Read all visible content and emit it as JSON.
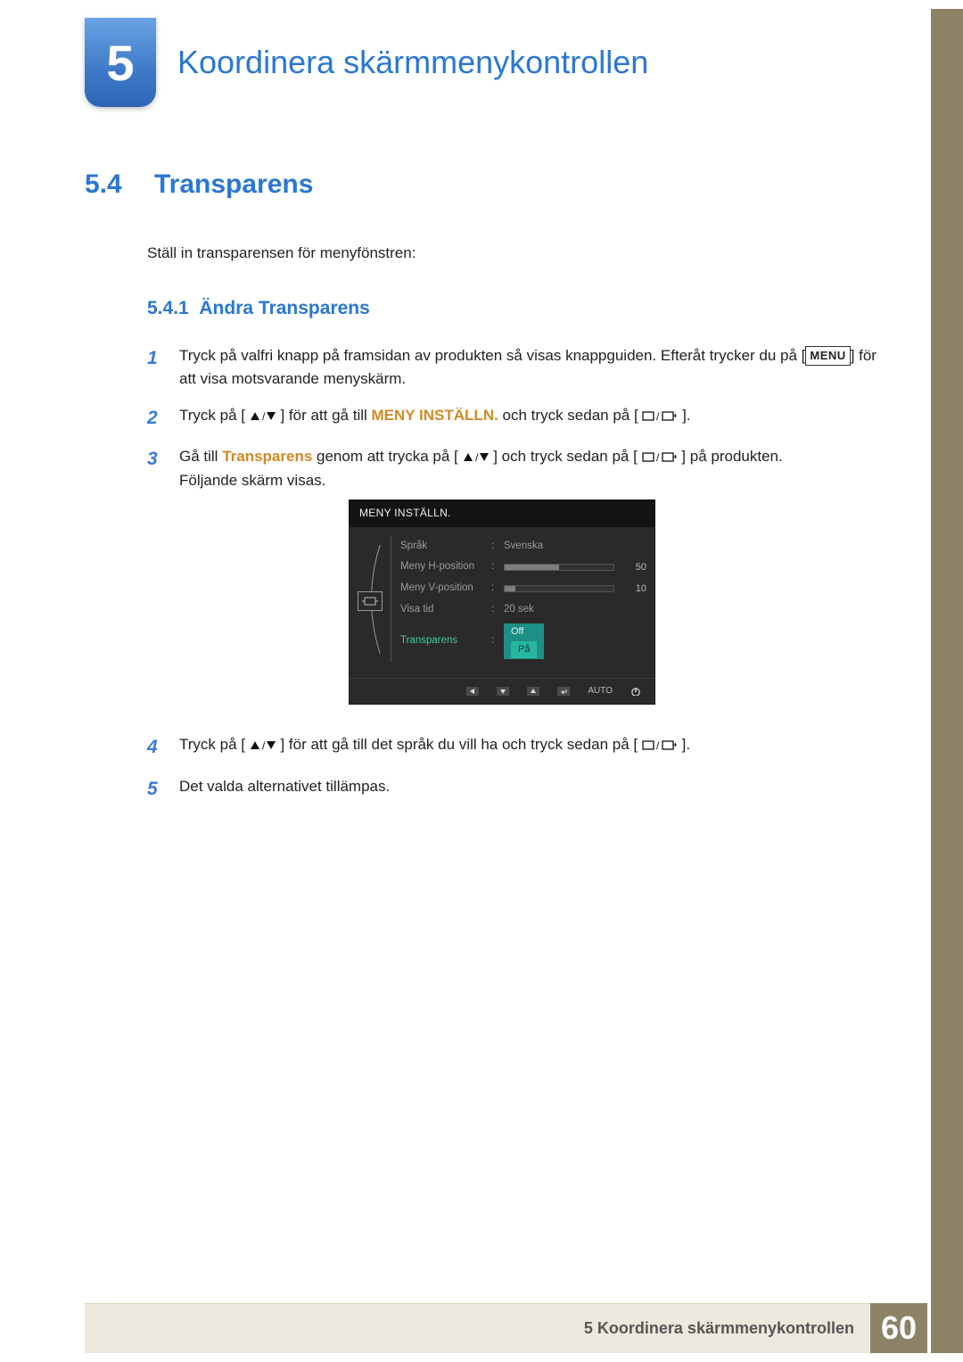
{
  "chapter": {
    "number": "5",
    "title": "Koordinera skärmmenykontrollen"
  },
  "section": {
    "number": "5.4",
    "title": "Transparens"
  },
  "intro": "Ställ in transparensen för menyfönstren:",
  "subsection": {
    "number": "5.4.1",
    "title": "Ändra Transparens"
  },
  "steps": {
    "s1": {
      "pre": "Tryck på valfri knapp på framsidan av produkten så visas knappguiden. Efteråt trycker du på [",
      "menu_label": "MENU",
      "post": "] för att visa motsvarande menyskärm."
    },
    "s2": {
      "pre": "Tryck på [",
      "mid": "] för att gå till ",
      "emph": "MENY INSTÄLLN.",
      "post": " och tryck sedan på [",
      "close": "]."
    },
    "s3": {
      "pre": "Gå till ",
      "emph": "Transparens",
      "mid": " genom att trycka på [",
      "mid2": "] och tryck sedan på [",
      "post": "] på produkten.",
      "after": "Följande skärm visas."
    },
    "s4": {
      "pre": "Tryck på [",
      "mid": "] för att gå till det språk du vill ha och tryck sedan på [",
      "post": "]."
    },
    "s5": "Det valda alternativet tillämpas."
  },
  "osd": {
    "title": "MENY INSTÄLLN.",
    "rows": {
      "language": {
        "label": "Språk",
        "value": "Svenska"
      },
      "hpos": {
        "label": "Meny H-position",
        "value": "50",
        "pct": 50
      },
      "vpos": {
        "label": "Meny V-position",
        "value": "10",
        "pct": 10
      },
      "time": {
        "label": "Visa tid",
        "value": "20 sek"
      },
      "transp": {
        "label": "Transparens",
        "opt1": "Off",
        "opt2": "På"
      }
    },
    "nav_auto": "AUTO"
  },
  "footer": {
    "caption": "5 Koordinera skärmmenykontrollen",
    "page": "60"
  }
}
